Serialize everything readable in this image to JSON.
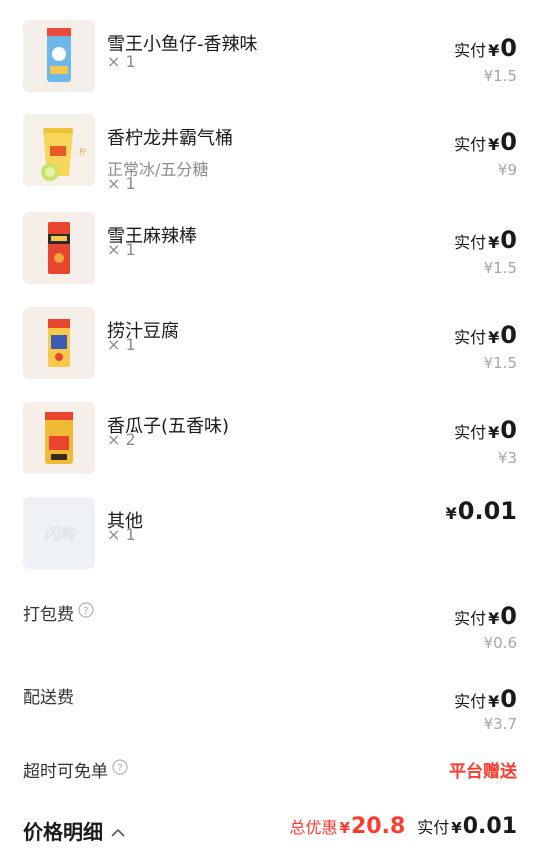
{
  "items": [
    {
      "name": "雪王小鱼仔-香辣味",
      "spec": "",
      "qty": "× 1",
      "pay_label": "实付",
      "currency": "¥",
      "pay_amount": "0",
      "original": "¥1.5",
      "thumb_icon": "snack-bag-blue-icon"
    },
    {
      "name": "香柠龙井霸气桶",
      "spec": "正常冰/五分糖",
      "qty": "× 1",
      "pay_label": "实付",
      "currency": "¥",
      "pay_amount": "0",
      "original": "¥9",
      "thumb_icon": "lemon-tea-bucket-icon"
    },
    {
      "name": "雪王麻辣棒",
      "spec": "",
      "qty": "× 1",
      "pay_label": "实付",
      "currency": "¥",
      "pay_amount": "0",
      "original": "¥1.5",
      "thumb_icon": "spicy-stick-bag-icon"
    },
    {
      "name": "捞汁豆腐",
      "spec": "",
      "qty": "× 1",
      "pay_label": "实付",
      "currency": "¥",
      "pay_amount": "0",
      "original": "¥1.5",
      "thumb_icon": "tofu-snack-bag-icon"
    },
    {
      "name": "香瓜子(五香味)",
      "spec": "",
      "qty": "× 2",
      "pay_label": "实付",
      "currency": "¥",
      "pay_amount": "0",
      "original": "¥3",
      "thumb_icon": "sunflower-seeds-bag-icon"
    },
    {
      "name": "其他",
      "spec": "",
      "qty": "× 1",
      "pay_label": "",
      "currency": "¥",
      "pay_amount": "0.01",
      "original": "",
      "thumb_icon": "placeholder-logo-icon",
      "thumb_text": "闪购"
    }
  ],
  "fees": {
    "packing": {
      "label": "打包费",
      "pay_label": "实付",
      "currency": "¥",
      "pay_amount": "0",
      "original": "¥0.6"
    },
    "delivery": {
      "label": "配送费",
      "pay_label": "实付",
      "currency": "¥",
      "pay_amount": "0",
      "original": "¥3.7"
    },
    "overtime": {
      "label": "超时可免单",
      "value": "平台赠送"
    }
  },
  "summary": {
    "title": "价格明细",
    "discount_label": "总优惠",
    "discount_currency": "¥",
    "discount_amount": "20.8",
    "total_label": "实付",
    "total_currency": "¥",
    "total_amount": "0.01"
  },
  "colors": {
    "accent_red": "#ff3b30",
    "muted": "#8c8c8c"
  }
}
